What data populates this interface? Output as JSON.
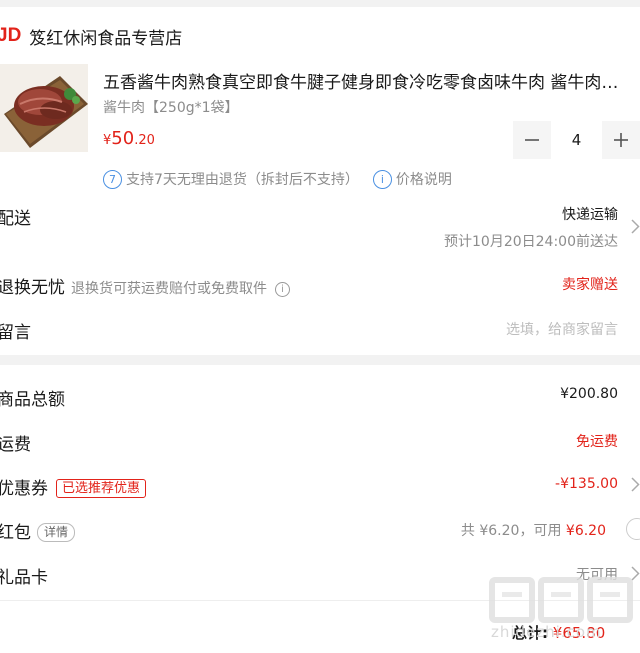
{
  "store": {
    "logo": "JD",
    "name": "笈红休闲食品专营店"
  },
  "product": {
    "title": "五香酱牛肉熟食真空即食牛腱子健身即食冷吃零食卤味牛肉 酱牛肉…",
    "spec": "酱牛肉【250g*1袋】",
    "price_currency": "¥",
    "price_int": "50",
    "price_dec": ".20",
    "quantity": "4",
    "minus_icon": "minus-icon",
    "plus_icon": "plus-icon"
  },
  "tags": {
    "return_badge": "7",
    "return_text": "支持7天无理由退货（拆封后不支持）",
    "price_info_icon": "i",
    "price_info": "价格说明"
  },
  "delivery": {
    "label": "配送",
    "method": "快递运输",
    "eta": "预计10月20日24:00前送达"
  },
  "return_service": {
    "label": "退换无忧",
    "note": "退换货可获运费赔付或免费取件",
    "info_icon": "i",
    "value": "卖家赠送"
  },
  "message": {
    "label": "留言",
    "placeholder": "选填，给商家留言"
  },
  "summary": {
    "goods_total_label": "商品总额",
    "goods_total": "¥200.80",
    "shipping_label": "运费",
    "shipping": "免运费",
    "coupon_label": "优惠券",
    "coupon_badge": "已选推荐优惠",
    "coupon_value": "-¥135.00",
    "redpacket_label": "红包",
    "redpacket_detail": "详情",
    "redpacket_avail": "共 ¥6.20，可用",
    "redpacket_value": "¥6.20",
    "giftcard_label": "礼品卡",
    "giftcard_value": "无可用"
  },
  "footer": {
    "total_label": "总计:",
    "total_value": "¥65.80",
    "watermark_text": "zhidezhi.com"
  },
  "colors": {
    "accent": "#e2231a",
    "info_blue": "#4a90e2",
    "muted": "#8c8c8c"
  }
}
